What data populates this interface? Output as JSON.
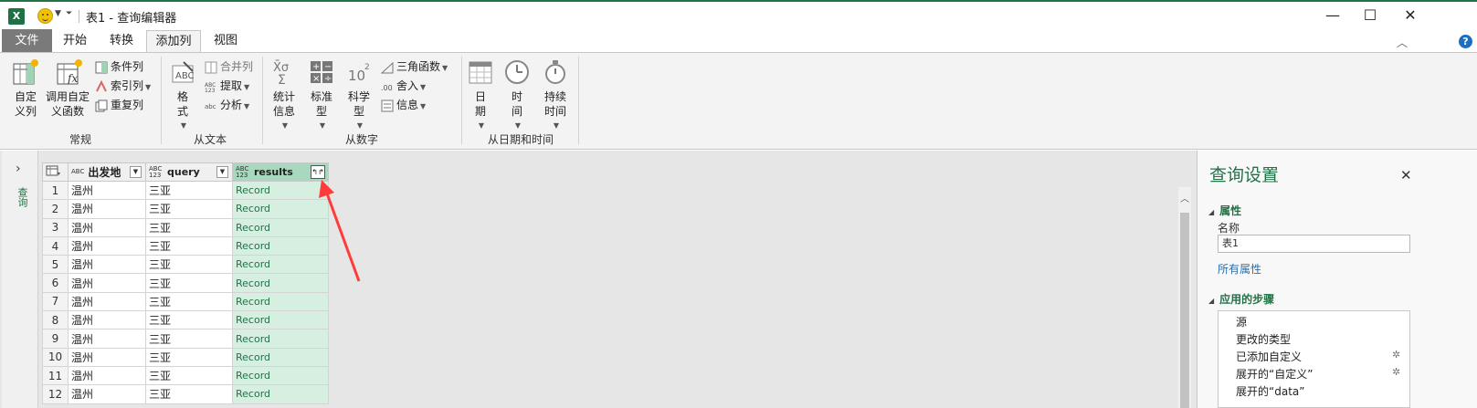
{
  "title": "表1 - 查询编辑器",
  "app_icon": "X",
  "window_controls": {
    "minimize": "—",
    "maximize": "☐",
    "close": "✕"
  },
  "tabs": [
    {
      "label": "文件"
    },
    {
      "label": "开始"
    },
    {
      "label": "转换"
    },
    {
      "label": "添加列"
    },
    {
      "label": "视图"
    }
  ],
  "active_tab": "添加列",
  "ribbon": {
    "general": {
      "custom_col_1": "自定",
      "custom_col_2": "义列",
      "invoke_fn_1": "调用自定",
      "invoke_fn_2": "义函数",
      "conditional": "条件列",
      "index": "索引列",
      "duplicate": "重复列",
      "label": "常规"
    },
    "from_text": {
      "format_1": "格",
      "format_2": "式",
      "merge": "合并列",
      "extract": "提取",
      "parse": "分析",
      "label": "从文本"
    },
    "from_number": {
      "stats_1": "统计",
      "stats_2": "信息",
      "standard_1": "标准",
      "standard_2": "型",
      "sci_1": "科学",
      "sci_2": "型",
      "trig": "三角函数",
      "round": "舍入",
      "info": "信息",
      "label": "从数字"
    },
    "from_datetime": {
      "date_1": "日",
      "date_2": "期",
      "time_1": "时",
      "time_2": "间",
      "duration_1": "持续",
      "duration_2": "时间",
      "label": "从日期和时间"
    }
  },
  "left_nav": {
    "label": "查询"
  },
  "table": {
    "columns": [
      {
        "type": "ABC",
        "name": "出发地"
      },
      {
        "type": "ABC 123",
        "name": "query"
      },
      {
        "type": "ABC 123",
        "name": "results"
      }
    ],
    "rows": [
      {
        "n": "1",
        "from": "温州",
        "query": "三亚",
        "results": "Record"
      },
      {
        "n": "2",
        "from": "温州",
        "query": "三亚",
        "results": "Record"
      },
      {
        "n": "3",
        "from": "温州",
        "query": "三亚",
        "results": "Record"
      },
      {
        "n": "4",
        "from": "温州",
        "query": "三亚",
        "results": "Record"
      },
      {
        "n": "5",
        "from": "温州",
        "query": "三亚",
        "results": "Record"
      },
      {
        "n": "6",
        "from": "温州",
        "query": "三亚",
        "results": "Record"
      },
      {
        "n": "7",
        "from": "温州",
        "query": "三亚",
        "results": "Record"
      },
      {
        "n": "8",
        "from": "温州",
        "query": "三亚",
        "results": "Record"
      },
      {
        "n": "9",
        "from": "温州",
        "query": "三亚",
        "results": "Record"
      },
      {
        "n": "10",
        "from": "温州",
        "query": "三亚",
        "results": "Record"
      },
      {
        "n": "11",
        "from": "温州",
        "query": "三亚",
        "results": "Record"
      },
      {
        "n": "12",
        "from": "温州",
        "query": "三亚",
        "results": "Record"
      }
    ]
  },
  "query_settings": {
    "title": "查询设置",
    "properties_label": "属性",
    "name_label": "名称",
    "name_value": "表1",
    "all_properties": "所有属性",
    "steps_label": "应用的步骤",
    "steps": [
      "源",
      "更改的类型",
      "已添加自定义",
      "展开的“自定义”",
      "展开的“data”"
    ]
  },
  "colors": {
    "accent": "#217346",
    "selected_column": "#a8d8bd",
    "record_cell": "#d6efe1",
    "annotation_arrow": "#ff3b3b"
  }
}
